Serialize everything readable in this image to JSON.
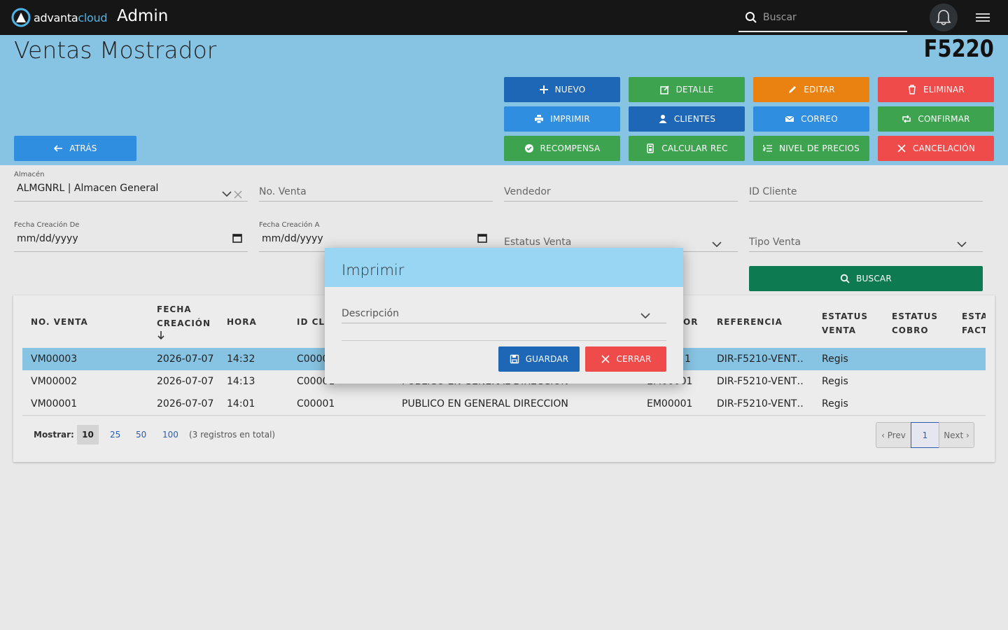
{
  "topbar": {
    "brand_a": "advanta",
    "brand_b": "cloud",
    "app": "Admin",
    "search_placeholder": "Buscar"
  },
  "page": {
    "title": "Ventas Mostrador",
    "code": "F5220"
  },
  "actions": {
    "nuevo": "NUEVO",
    "detalle": "DETALLE",
    "editar": "EDITAR",
    "eliminar": "ELIMINAR",
    "imprimir": "IMPRIMIR",
    "clientes": "CLIENTES",
    "correo": "CORREO",
    "confirmar": "CONFIRMAR",
    "recompensa": "RECOMPENSA",
    "calcular": "CALCULAR REC",
    "nivel": "NIVEL DE PRECIOS",
    "cancelacion": "CANCELACIÓN",
    "atras": "ATRÁS",
    "buscar": "BUSCAR"
  },
  "filters": {
    "almacen_label": "Almacén",
    "almacen_value": "ALMGNRL | Almacen General",
    "no_venta": "No. Venta",
    "vendedor": "Vendedor",
    "id_cliente": "ID Cliente",
    "fecha_de_label": "Fecha Creación De",
    "fecha_de_value": "mm/dd/yyyy",
    "fecha_a_label": "Fecha Creación A",
    "fecha_a_value": "mm/dd/yyyy",
    "estatus_venta": "Estatus Venta",
    "tipo_venta": "Tipo Venta"
  },
  "table": {
    "headers": {
      "no_venta": "NO. VENTA",
      "fecha_1": "FECHA",
      "fecha_2": "CREACIÓN",
      "hora": "HORA",
      "id_cli": "ID CLI",
      "vendedor_frag": "OR",
      "referencia": "REFERENCIA",
      "est_venta_1": "ESTATUS",
      "est_venta_2": "VENTA",
      "est_cobro_1": "ESTATUS",
      "est_cobro_2": "COBRO",
      "est_fact_1": "ESTA",
      "est_fact_2": "FACT"
    },
    "rows": [
      {
        "no": "VM00003",
        "fecha": "2026-07-07",
        "hora": "14:32",
        "id": "C0000",
        "cliente": "",
        "vend": "1",
        "ref": "DIR-F5210-VENT…",
        "estatus": "Regis"
      },
      {
        "no": "VM00002",
        "fecha": "2026-07-07",
        "hora": "14:13",
        "id": "C00001",
        "cliente": "PUBLICO EN GENERAL DIRECCION",
        "vend": "EM00001",
        "ref": "DIR-F5210-VENT…",
        "estatus": "Regis"
      },
      {
        "no": "VM00001",
        "fecha": "2026-07-07",
        "hora": "14:01",
        "id": "C00001",
        "cliente": "PUBLICO EN GENERAL DIRECCION",
        "vend": "EM00001",
        "ref": "DIR-F5210-VENT…",
        "estatus": "Regis"
      }
    ]
  },
  "footer": {
    "mostrar": "Mostrar:",
    "sizes": [
      "10",
      "25",
      "50",
      "100"
    ],
    "total": "(3 registros en total)",
    "prev": "‹ Prev",
    "page": "1",
    "next": "Next ›"
  },
  "modal": {
    "title": "Imprimir",
    "descripcion": "Descripción",
    "guardar": "GUARDAR",
    "cerrar": "CERRAR"
  }
}
